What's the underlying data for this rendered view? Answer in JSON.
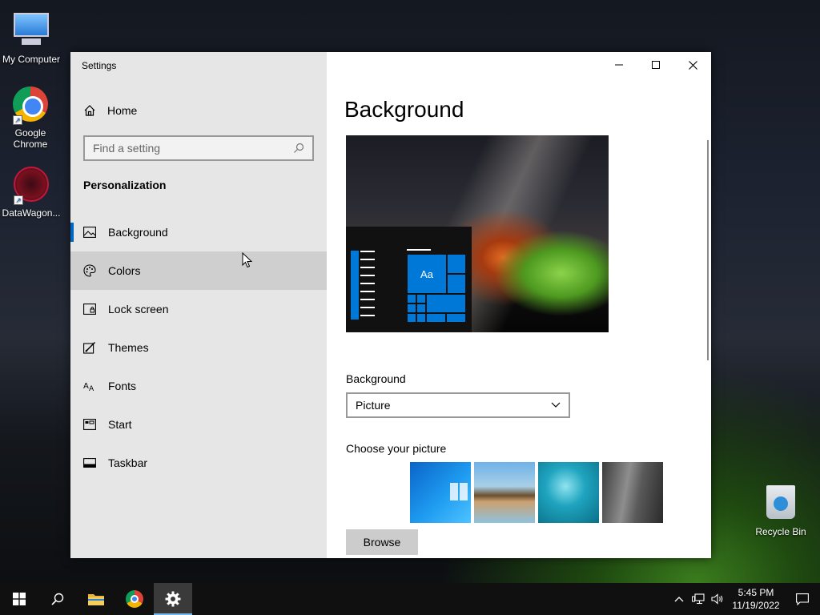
{
  "desktop": {
    "icons": [
      {
        "label": "My Computer"
      },
      {
        "label": "Google Chrome"
      },
      {
        "label": "DataWagon..."
      },
      {
        "label": "Recycle Bin"
      }
    ]
  },
  "window": {
    "title": "Settings",
    "nav": {
      "home_label": "Home",
      "search_placeholder": "Find a setting",
      "section": "Personalization",
      "items": [
        {
          "label": "Background",
          "icon": "image-icon"
        },
        {
          "label": "Colors",
          "icon": "palette-icon"
        },
        {
          "label": "Lock screen",
          "icon": "lock-screen-icon"
        },
        {
          "label": "Themes",
          "icon": "themes-icon"
        },
        {
          "label": "Fonts",
          "icon": "fonts-icon"
        },
        {
          "label": "Start",
          "icon": "start-icon"
        },
        {
          "label": "Taskbar",
          "icon": "taskbar-icon"
        }
      ]
    },
    "content": {
      "page_title": "Background",
      "preview_tile_text": "Aa",
      "background_label": "Background",
      "background_value": "Picture",
      "choose_label": "Choose your picture",
      "browse_label": "Browse"
    }
  },
  "taskbar": {
    "time": "5:45 PM",
    "date": "11/19/2022"
  },
  "colors": {
    "accent": "#0078d7",
    "nav_bg": "#e6e6e6",
    "taskbar_bg": "#101010"
  }
}
